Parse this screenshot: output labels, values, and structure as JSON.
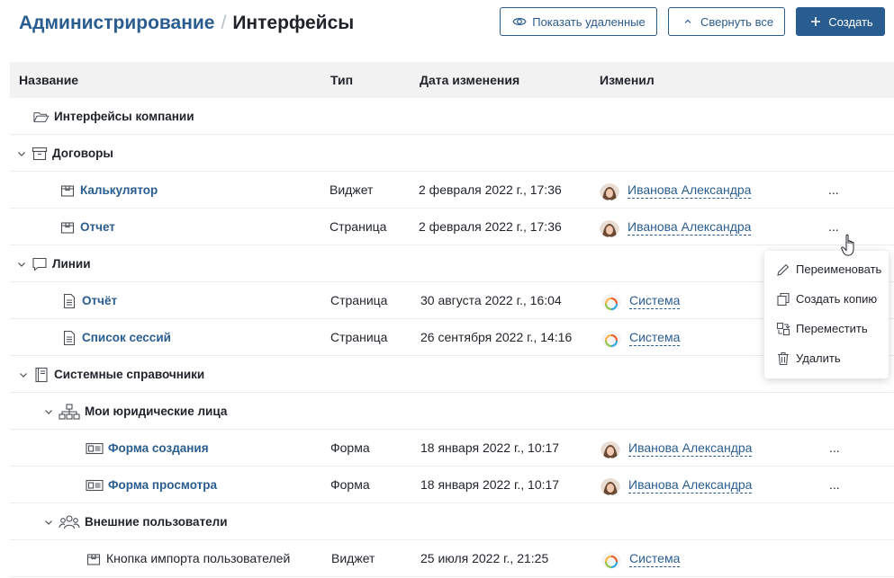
{
  "header": {
    "breadcrumb_parent": "Администрирование",
    "breadcrumb_separator": "/",
    "breadcrumb_current": "Интерфейсы",
    "show_deleted_label": "Показать удаленные",
    "collapse_all_label": "Свернуть все",
    "create_label": "Создать"
  },
  "table": {
    "columns": [
      "Название",
      "Тип",
      "Дата изменения",
      "Изменил"
    ],
    "rows": [
      {
        "name": "Интерфейсы компании",
        "type": "",
        "date": "",
        "author": ""
      },
      {
        "name": "Договоры",
        "type": "",
        "date": "",
        "author": ""
      },
      {
        "name": "Калькулятор",
        "type": "Виджет",
        "date": "2 февраля 2022 г., 17:36",
        "author": "Иванова Александра",
        "more": "..."
      },
      {
        "name": "Отчет",
        "type": "Страница",
        "date": "2 февраля 2022 г., 17:36",
        "author": "Иванова Александра",
        "more": "..."
      },
      {
        "name": "Линии",
        "type": "",
        "date": "",
        "author": ""
      },
      {
        "name": "Отчёт",
        "type": "Страница",
        "date": "30 августа 2022 г., 16:04",
        "author": "Система"
      },
      {
        "name": "Список сессий",
        "type": "Страница",
        "date": "26 сентября 2022 г., 14:16",
        "author": "Система"
      },
      {
        "name": "Системные справочники",
        "type": "",
        "date": "",
        "author": ""
      },
      {
        "name": "Мои юридические лица",
        "type": "",
        "date": "",
        "author": ""
      },
      {
        "name": "Форма создания",
        "type": "Форма",
        "date": "18 января 2022 г., 10:17",
        "author": "Иванова Александра",
        "more": "..."
      },
      {
        "name": "Форма просмотра",
        "type": "Форма",
        "date": "18 января 2022 г., 10:17",
        "author": "Иванова Александра",
        "more": "..."
      },
      {
        "name": "Внешние пользователи",
        "type": "",
        "date": "",
        "author": ""
      },
      {
        "name": "Кнопка импорта пользователей",
        "type": "Виджет",
        "date": "25 июля 2022 г., 21:25",
        "author": "Система"
      }
    ]
  },
  "context_menu": {
    "items": [
      "Переименовать",
      "Создать копию",
      "Переместить",
      "Удалить"
    ]
  },
  "colors": {
    "accent": "#2a5d8f",
    "header_bg": "#f2f2f2",
    "text": "#1f2329"
  }
}
